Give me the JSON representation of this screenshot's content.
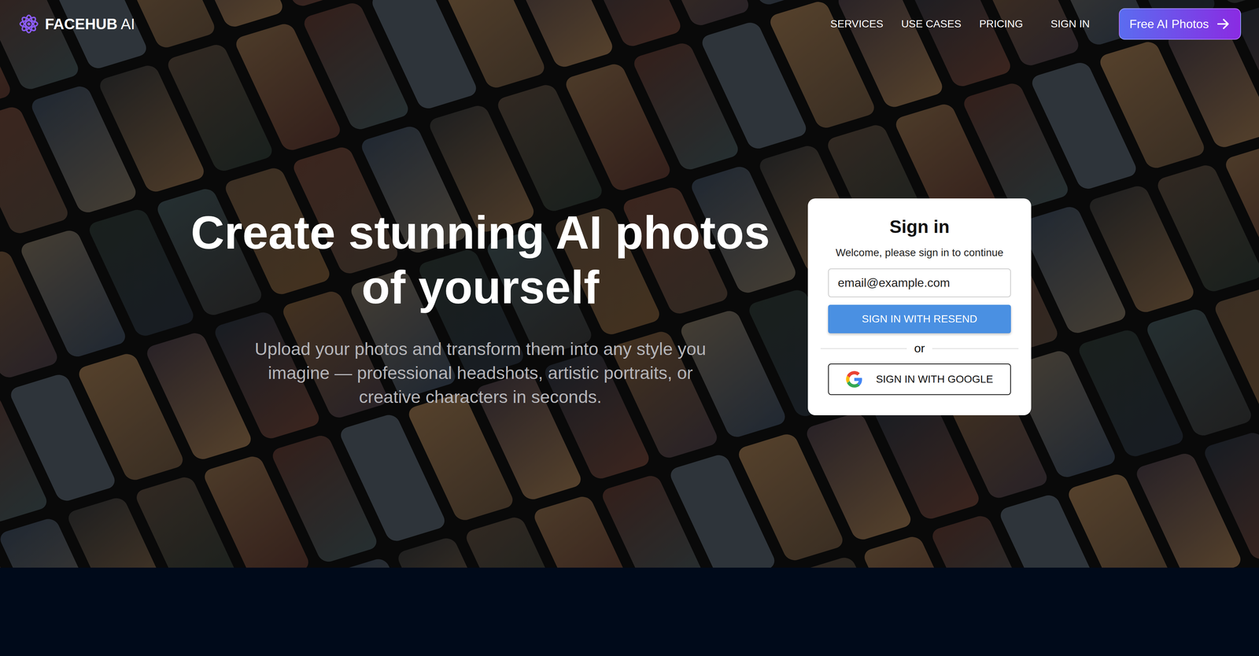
{
  "logo": {
    "brand": "FACEHUB",
    "suffix": "AI"
  },
  "nav": {
    "links": [
      "SERVICES",
      "USE CASES",
      "PRICING",
      "SIGN IN"
    ],
    "cta": "Free AI Photos"
  },
  "hero": {
    "title": "Create stunning AI photos of yourself",
    "subtitle": "Upload your photos and transform them into any style you imagine — professional headshots, artistic portraits, or creative characters in seconds."
  },
  "signin": {
    "title": "Sign in",
    "welcome": "Welcome, please sign in to continue",
    "email_placeholder": "email@example.com",
    "resend_button": "SIGN IN WITH RESEND",
    "divider": "or",
    "google_button": "SIGN IN WITH GOOGLE"
  }
}
